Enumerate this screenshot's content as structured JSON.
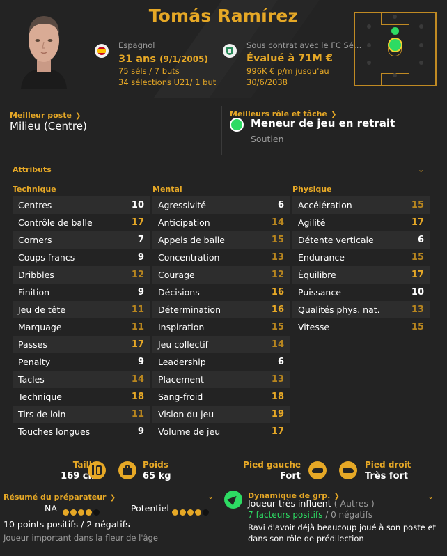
{
  "player": {
    "name": "Tomás Ramírez",
    "nationality": "Espagnol",
    "age": "31 ans",
    "dob": "(9/1/2005)",
    "caps": "75 séls / 7 buts",
    "u21": "34 sélections U21/ 1 but",
    "contract": "Sous contrat avec le FC Sé…",
    "value": "Évalué à 71M €",
    "wage": "996K € p/m jusqu'au",
    "contract_end": "30/6/2038"
  },
  "best_position": {
    "label": "Meilleur poste",
    "value": "Milieu (Centre)"
  },
  "best_role": {
    "label": "Meilleurs rôle et tâche",
    "role": "Meneur de jeu en retrait",
    "duty": "Soutien"
  },
  "attributes": {
    "title": "Attributs",
    "technique": {
      "title": "Technique",
      "rows": [
        {
          "name": "Centres",
          "value": "10",
          "tier": "white"
        },
        {
          "name": "Contrôle de balle",
          "value": "17",
          "tier": "gold"
        },
        {
          "name": "Corners",
          "value": "7",
          "tier": "white"
        },
        {
          "name": "Coups francs",
          "value": "9",
          "tier": "white"
        },
        {
          "name": "Dribbles",
          "value": "12",
          "tier": "dim"
        },
        {
          "name": "Finition",
          "value": "9",
          "tier": "white"
        },
        {
          "name": "Jeu de tête",
          "value": "11",
          "tier": "dim"
        },
        {
          "name": "Marquage",
          "value": "11",
          "tier": "dim"
        },
        {
          "name": "Passes",
          "value": "17",
          "tier": "gold"
        },
        {
          "name": "Penalty",
          "value": "9",
          "tier": "white"
        },
        {
          "name": "Tacles",
          "value": "14",
          "tier": "dim"
        },
        {
          "name": "Technique",
          "value": "18",
          "tier": "gold"
        },
        {
          "name": "Tirs de loin",
          "value": "11",
          "tier": "dim"
        },
        {
          "name": "Touches longues",
          "value": "9",
          "tier": "white"
        }
      ]
    },
    "mental": {
      "title": "Mental",
      "rows": [
        {
          "name": "Agressivité",
          "value": "6",
          "tier": "white"
        },
        {
          "name": "Anticipation",
          "value": "14",
          "tier": "dim"
        },
        {
          "name": "Appels de balle",
          "value": "15",
          "tier": "dim"
        },
        {
          "name": "Concentration",
          "value": "13",
          "tier": "dim"
        },
        {
          "name": "Courage",
          "value": "12",
          "tier": "dim"
        },
        {
          "name": "Décisions",
          "value": "16",
          "tier": "gold"
        },
        {
          "name": "Détermination",
          "value": "16",
          "tier": "gold"
        },
        {
          "name": "Inspiration",
          "value": "15",
          "tier": "dim"
        },
        {
          "name": "Jeu collectif",
          "value": "14",
          "tier": "dim"
        },
        {
          "name": "Leadership",
          "value": "6",
          "tier": "white"
        },
        {
          "name": "Placement",
          "value": "13",
          "tier": "dim"
        },
        {
          "name": "Sang-froid",
          "value": "18",
          "tier": "gold"
        },
        {
          "name": "Vision du jeu",
          "value": "19",
          "tier": "gold"
        },
        {
          "name": "Volume de jeu",
          "value": "17",
          "tier": "gold"
        }
      ]
    },
    "physique": {
      "title": "Physique",
      "rows": [
        {
          "name": "Accélération",
          "value": "15",
          "tier": "dim"
        },
        {
          "name": "Agilité",
          "value": "17",
          "tier": "gold"
        },
        {
          "name": "Détente verticale",
          "value": "6",
          "tier": "white"
        },
        {
          "name": "Endurance",
          "value": "15",
          "tier": "dim"
        },
        {
          "name": "Équilibre",
          "value": "17",
          "tier": "gold"
        },
        {
          "name": "Puissance",
          "value": "10",
          "tier": "white"
        },
        {
          "name": "Qualités phys. nat.",
          "value": "13",
          "tier": "dim"
        },
        {
          "name": "Vitesse",
          "value": "15",
          "tier": "dim"
        }
      ]
    }
  },
  "physical": {
    "height_label": "Taille",
    "height": "169 cm",
    "weight_label": "Poids",
    "weight": "65 kg",
    "left_foot_label": "Pied gauche",
    "left_foot": "Fort",
    "right_foot_label": "Pied droit",
    "right_foot": "Très fort"
  },
  "coach_report": {
    "title": "Résumé du préparateur",
    "na_label": "NA",
    "na_stars": 4,
    "potential_label": "Potentiel",
    "potential_stars": 4,
    "stars_max": 5,
    "summary": "10 points positifs / 2 négatifs",
    "note": "Joueur important dans la fleur de l'âge"
  },
  "group_dynamics": {
    "title": "Dynamique de grp.",
    "status": "Joueur très influent",
    "group": "( Autres )",
    "positive": "7 facteurs positifs",
    "sep": " / ",
    "negative": "0 négatifs",
    "note": "Ravi d'avoir déjà beaucoup joué à son poste et dans son rôle de prédilection"
  },
  "colors": {
    "accent": "#e6a826",
    "background": "#232323",
    "role_green": "#2ddb63",
    "dim_value": "#c08a23"
  },
  "icons": [
    "spain-flag-icon",
    "club-crest-icon",
    "height-icon",
    "weight-icon",
    "left-boot-icon",
    "right-boot-icon",
    "role-icon",
    "chevron-down-icon",
    "chevron-right-icon"
  ]
}
